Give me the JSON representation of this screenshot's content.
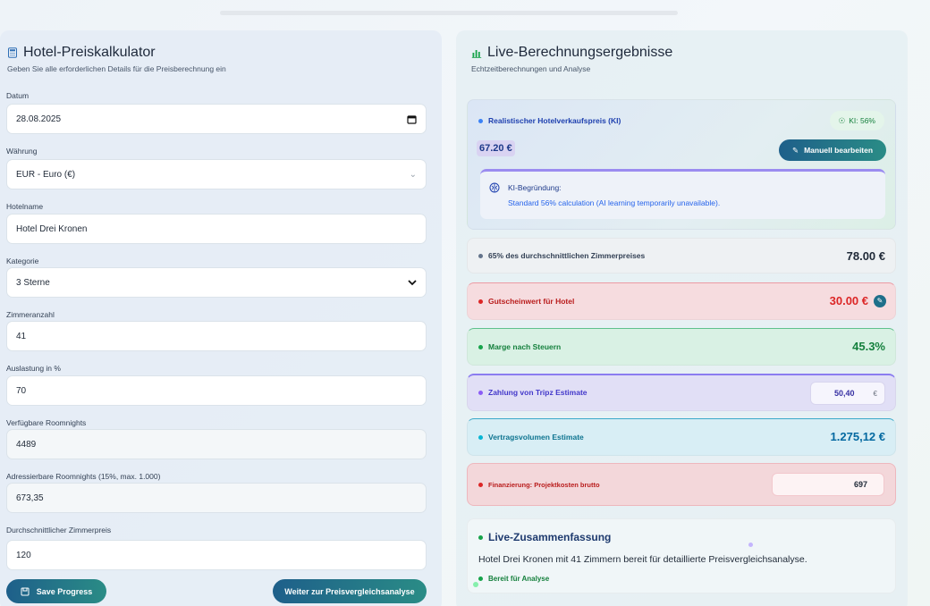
{
  "left": {
    "title": "Hotel-Preiskalkulator",
    "subtitle": "Geben Sie alle erforderlichen Details für die Preisberechnung ein",
    "fields": [
      {
        "label": "Datum",
        "value": "28.08.2025"
      },
      {
        "label": "Währung",
        "value": "EUR - Euro (€)"
      },
      {
        "label": "Hotelname",
        "value": "Hotel Drei Kronen"
      },
      {
        "label": "Kategorie",
        "value": "3 Sterne"
      },
      {
        "label": "Zimmeranzahl",
        "value": "41"
      },
      {
        "label": "Auslastung in %",
        "value": "70"
      },
      {
        "label": "Verfügbare Roomnights",
        "value": "4489"
      },
      {
        "label": "Adressierbare Roomnights (15%, max. 1.000)",
        "value": "673,35"
      },
      {
        "label": "Durchschnittlicher Zimmerpreis",
        "value": "120"
      }
    ],
    "save_label": "Save Progress",
    "next_label": "Weiter zur Preisvergleichsanalyse"
  },
  "right": {
    "title": "Live-Berechnungsergebnisse",
    "subtitle": "Echtzeitberechnungen und Analyse",
    "ki": {
      "label": "Realistischer Hotelverkaufspreis (KI)",
      "badge": "KI: 56%",
      "price": "67.20 €",
      "edit_label": "Manuell bearbeiten",
      "reason_title": "KI-Begründung:",
      "reason_text": "Standard 56% calculation (AI learning temporarily unavailable)."
    },
    "rows": {
      "avg65": {
        "label": "65% des durchschnittlichen Zimmerpreises",
        "value": "78.00 €"
      },
      "voucher": {
        "label": "Gutscheinwert für Hotel",
        "value": "30.00 €"
      },
      "margin": {
        "label": "Marge nach Steuern",
        "value": "45.3%"
      },
      "tripz": {
        "label": "Zahlung von Tripz Estimate",
        "value": "50,40",
        "unit": "€"
      },
      "contract": {
        "label": "Vertragsvolumen Estimate",
        "value": "1.275,12 €"
      },
      "financing": {
        "label": "Finanzierung: Projektkosten brutto",
        "value": "697"
      }
    },
    "summary": {
      "title": "Live-Zusammenfassung",
      "text": "Hotel Drei Kronen mit 41 Zimmern bereit für detaillierte Preisvergleichsanalyse.",
      "status": "Bereit für Analyse"
    }
  },
  "colors": {
    "accent": "#1e5f8a",
    "accent2": "#2a8c86",
    "danger": "#dc2626",
    "success": "#15803d",
    "purple": "#4c3fb8",
    "cyan": "#0e7490"
  }
}
